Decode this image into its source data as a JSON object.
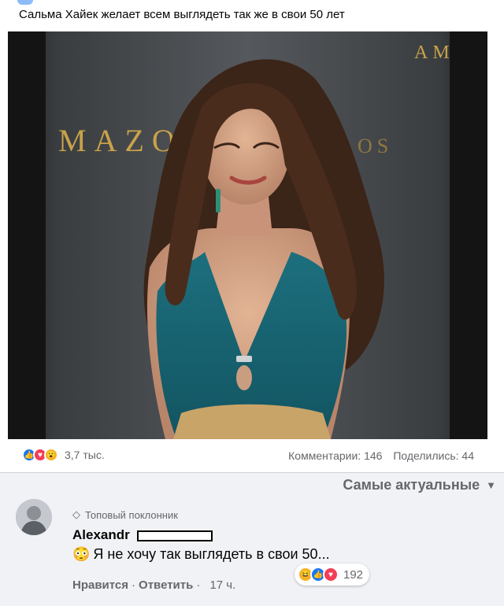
{
  "post": {
    "text": "Сальма Хайек желает всем выглядеть так же в свои 50 лет"
  },
  "photo": {
    "backdrop_text_left": "MAZO",
    "backdrop_text_left2": "OS",
    "backdrop_text_right": "AM"
  },
  "stats": {
    "reaction_icons": [
      "like-icon",
      "love-icon",
      "wow-icon"
    ],
    "reaction_count": "3,7 тыс.",
    "comments": "Комментарии: 146",
    "shares": "Поделились: 44"
  },
  "sort": {
    "label": "Самые актуальные"
  },
  "comment": {
    "badge": "Топовый поклонник",
    "author": "Alexandr",
    "text": "Я не хочу так выглядеть в свои 50...",
    "emoji": "😳",
    "reaction_count": "192",
    "like_label": "Нравится",
    "reply_label": "Ответить",
    "time": "17 ч."
  },
  "colors": {
    "like": "#1877f2",
    "love": "#f33e58",
    "wow": "#f7b125",
    "secondary_text": "#65676b"
  }
}
